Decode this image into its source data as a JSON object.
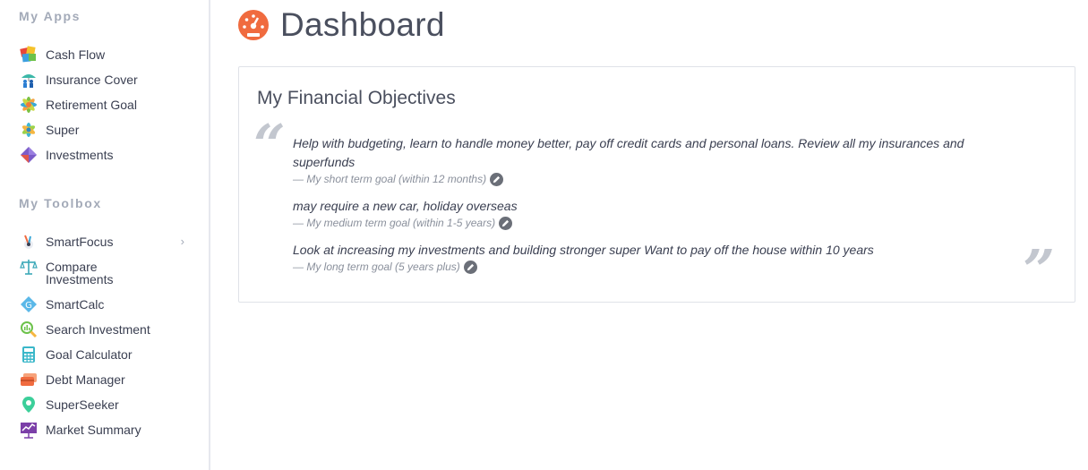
{
  "sidebar": {
    "my_apps_title": "My Apps",
    "my_apps": [
      {
        "label": "Cash Flow",
        "icon": "cash-flow-icon"
      },
      {
        "label": "Insurance Cover",
        "icon": "insurance-cover-icon"
      },
      {
        "label": "Retirement Goal",
        "icon": "retirement-goal-icon"
      },
      {
        "label": "Super",
        "icon": "super-icon"
      },
      {
        "label": "Investments",
        "icon": "investments-icon"
      }
    ],
    "toolbox_title": "My Toolbox",
    "toolbox": [
      {
        "label": "SmartFocus",
        "icon": "smartfocus-icon",
        "chevron": "›"
      },
      {
        "label": "Compare Investments",
        "icon": "scales-icon"
      },
      {
        "label": "SmartCalc",
        "icon": "smartcalc-icon"
      },
      {
        "label": "Search Investment",
        "icon": "search-investment-icon"
      },
      {
        "label": "Goal Calculator",
        "icon": "calculator-icon"
      },
      {
        "label": "Debt Manager",
        "icon": "credit-card-icon"
      },
      {
        "label": "SuperSeeker",
        "icon": "map-pin-icon"
      },
      {
        "label": "Market Summary",
        "icon": "chart-board-icon"
      }
    ]
  },
  "header": {
    "title": "Dashboard",
    "icon": "dashboard-gauge-icon",
    "accent": "#f06b3f"
  },
  "objectives": {
    "title": "My Financial Objectives",
    "open_quote": "“",
    "close_quote": "”",
    "goals": [
      {
        "text": "Help with budgeting, learn to handle money better, pay off credit cards and personal loans. Review all my insurances and superfunds",
        "meta": "— My short term goal (within 12 months)"
      },
      {
        "text": "may require a new car, holiday overseas",
        "meta": "— My medium term goal (within 1-5 years)"
      },
      {
        "text": "Look at increasing my investments and building stronger super Want to pay off the house within 10 years",
        "meta": "— My long term goal (5 years plus)"
      }
    ]
  }
}
